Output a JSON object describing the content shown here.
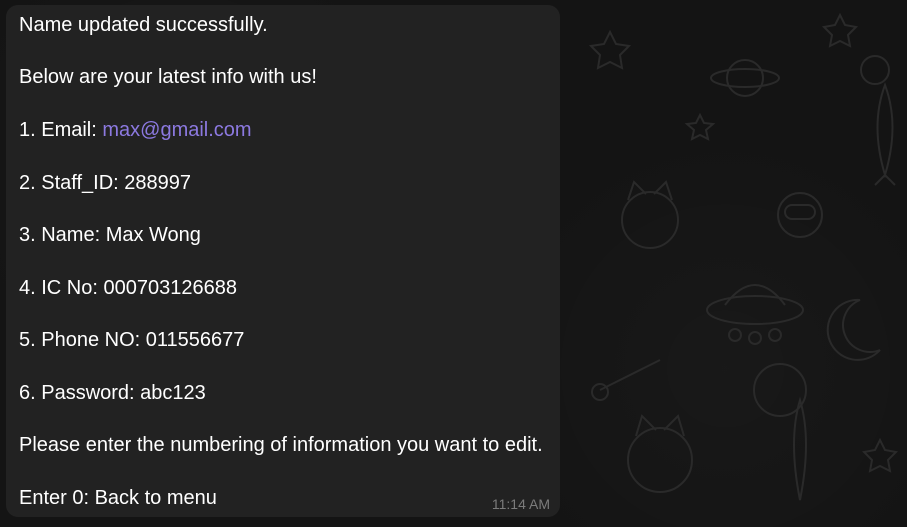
{
  "message": {
    "lines": [
      "Name updated successfully.",
      "Below are your latest info with us!",
      "1. Email: ",
      "2. Staff_ID: 288997",
      "3. Name: Max Wong",
      "4. IC No: 000703126688",
      "5. Phone NO: 011556677",
      "6. Password: abc123",
      "Please enter the numbering of information you want to edit.",
      "Enter 0: Back to menu"
    ],
    "email_link": "max@gmail.com",
    "timestamp": "11:14 AM"
  },
  "colors": {
    "background": "#141414",
    "bubble": "#222222",
    "text": "#ffffff",
    "link": "#8c79e0",
    "timestamp": "#7b7b7b",
    "doodle": "#2a2a2a"
  },
  "icons": [
    "planet-icon",
    "star-icon",
    "rocket-icon",
    "cat-icon",
    "astronaut-icon",
    "ufo-icon",
    "moon-icon",
    "comet-icon"
  ]
}
